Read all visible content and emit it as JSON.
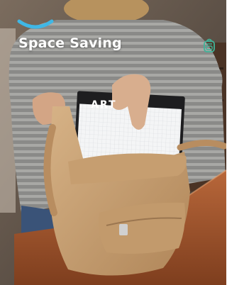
{
  "headline": "Space Saving",
  "brand_text": "ART",
  "icons": {
    "top_arc": "arc-accent-icon",
    "badge": "backpack-icon"
  },
  "colors": {
    "accent": "#3fb7e6",
    "badge": "#3fb59a",
    "headline": "#ffffff"
  }
}
